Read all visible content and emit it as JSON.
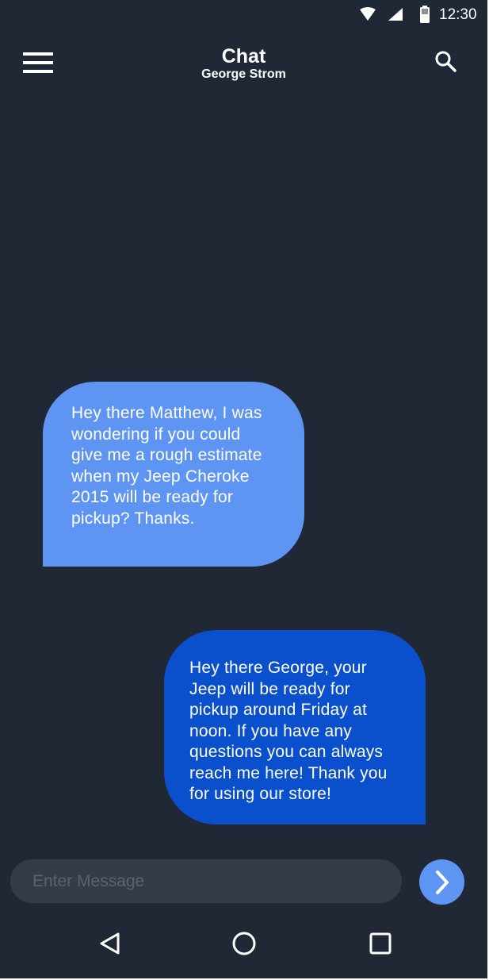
{
  "status_bar": {
    "time": "12:30",
    "icons": [
      "wifi-icon",
      "signal-icon",
      "battery-icon"
    ]
  },
  "app_bar": {
    "title": "Chat",
    "subtitle": "George Strom",
    "menu_icon": "hamburger-menu-icon",
    "search_icon": "search-icon"
  },
  "messages": [
    {
      "sender": "received",
      "text": "Hey there Matthew, I was wondering if you could give me a rough estimate when my Jeep Cheroke 2015 will be ready for pickup? Thanks."
    },
    {
      "sender": "sent",
      "text": "Hey there George, your Jeep will be ready for pickup around Friday at noon. If you have any questions you can always reach me here! Thank you for using our store!"
    }
  ],
  "composer": {
    "placeholder": "Enter Message",
    "value": "",
    "send_icon": "chevron-right-icon"
  },
  "nav_bar": {
    "buttons": [
      "back-icon",
      "home-icon",
      "recents-icon"
    ]
  },
  "colors": {
    "background": "#212835",
    "received_bubble": "#5e95f3",
    "sent_bubble": "#0a50cc",
    "input_background": "#353c47",
    "send_button": "#5e95f3"
  }
}
